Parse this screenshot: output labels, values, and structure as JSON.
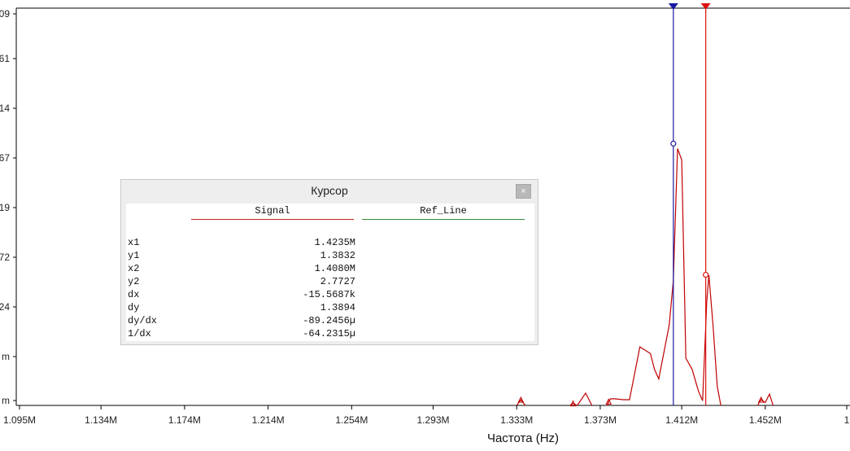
{
  "chart_data": {
    "type": "line",
    "title": "",
    "xlabel": "Частота (Hz)",
    "ylabel": "",
    "x_tick_labels": [
      "1.095M",
      "1.134M",
      "1.174M",
      "1.214M",
      "1.254M",
      "1.293M",
      "1.333M",
      "1.373M",
      "1.412M",
      "1.452M",
      "1"
    ],
    "x_ticks": [
      1.095,
      1.134,
      1.174,
      1.214,
      1.254,
      1.293,
      1.333,
      1.373,
      1.412,
      1.452,
      1.491
    ],
    "xlim": [
      1.095,
      1.491
    ],
    "y_tick_labels": [
      "09",
      "61",
      "14",
      "67",
      "19",
      "72",
      "24",
      "m",
      "m"
    ],
    "series": [
      {
        "color": "#c00000",
        "x": [
          1.333,
          1.334,
          1.335,
          1.336,
          1.338,
          1.358,
          1.359,
          1.36,
          1.362,
          1.366,
          1.369,
          1.372,
          1.376,
          1.377,
          1.378,
          1.38,
          1.384,
          1.387,
          1.392,
          1.397,
          1.399,
          1.401,
          1.406,
          1.408,
          1.41,
          1.412,
          1.414,
          1.417,
          1.42,
          1.422,
          1.424,
          1.425,
          1.427,
          1.429,
          1.431,
          1.448,
          1.449,
          1.45,
          1.452,
          1.454,
          1.456
        ],
        "y": [
          0.0,
          0.03,
          0.06,
          0.03,
          -0.02,
          -0.03,
          0.01,
          0.02,
          0.0,
          0.13,
          0.0,
          -0.03,
          -0.03,
          0.04,
          0.07,
          0.07,
          0.06,
          0.06,
          0.62,
          0.55,
          0.38,
          0.28,
          0.85,
          1.32,
          2.72,
          2.6,
          0.5,
          0.38,
          0.15,
          0.05,
          1.1,
          1.38,
          0.85,
          0.2,
          -0.03,
          -0.03,
          0.03,
          0.06,
          0.03,
          0.12,
          -0.02
        ]
      }
    ],
    "cursors": [
      {
        "x": 1.408,
        "y": 2.7727,
        "color": "#1a1aa0"
      },
      {
        "x": 1.4235,
        "y": 1.3832,
        "color": "#dd1111"
      }
    ]
  },
  "cursor_window": {
    "title": "Курсор",
    "close_label": "×",
    "columns": [
      {
        "name": "Signal",
        "color": "#cc2222"
      },
      {
        "name": "Ref_Line",
        "color": "#3a8a3a"
      }
    ],
    "rows": [
      {
        "label": "x1",
        "value": "1.4235M"
      },
      {
        "label": "y1",
        "value": "1.3832"
      },
      {
        "label": "x2",
        "value": "1.4080M"
      },
      {
        "label": "y2",
        "value": "2.7727"
      },
      {
        "label": "dx",
        "value": "-15.5687k"
      },
      {
        "label": "dy",
        "value": "1.3894"
      },
      {
        "label": "dy/dx",
        "value": "-89.2456µ"
      },
      {
        "label": "1/dx",
        "value": "-64.2315µ"
      }
    ]
  }
}
